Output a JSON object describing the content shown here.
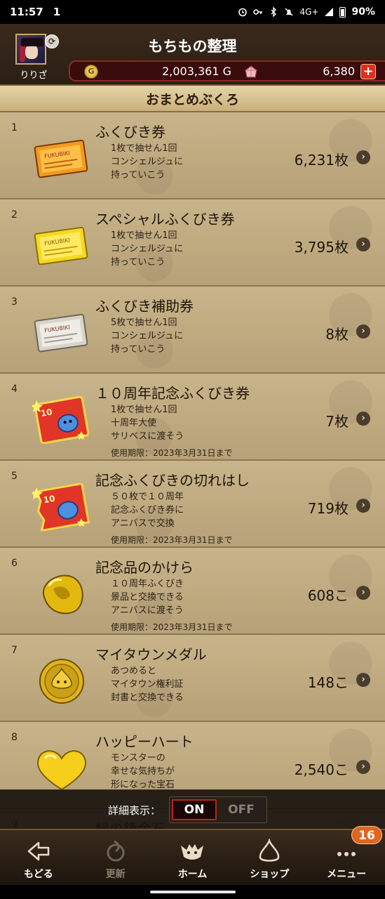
{
  "status_bar": {
    "time": "11:57",
    "notification": "1",
    "network": "4G+",
    "battery": "90%"
  },
  "header": {
    "title": "もちもの整理",
    "player_name": "りりざ",
    "gold": {
      "icon_label": "G",
      "amount": "2,003,361 G"
    },
    "gems": {
      "amount": "6,380"
    },
    "plus_label": "+"
  },
  "section_title": "おまとめぶくろ",
  "items": [
    {
      "num": "1",
      "title": "ふくびき券",
      "desc": [
        "1枚で抽せん1回",
        "コンシェルジュに",
        "持っていこう"
      ],
      "expiry": "",
      "count": "6,231枚",
      "icon": "ticket-orange-icon"
    },
    {
      "num": "2",
      "title": "スペシャルふくびき券",
      "desc": [
        "1枚で抽せん1回",
        "コンシェルジュに",
        "持っていこう"
      ],
      "expiry": "",
      "count": "3,795枚",
      "icon": "ticket-gold-icon"
    },
    {
      "num": "3",
      "title": "ふくびき補助券",
      "desc": [
        "5枚で抽せん1回",
        "コンシェルジュに",
        "持っていこう"
      ],
      "expiry": "",
      "count": "8枚",
      "icon": "ticket-silver-icon"
    },
    {
      "num": "4",
      "title": "１０周年記念ふくびき券",
      "desc": [
        "1枚で抽せん1回",
        "十周年大使",
        "サリベスに渡そう"
      ],
      "expiry": "使用期限：2023年3月31日まで",
      "count": "7枚",
      "icon": "anniversary-ticket-icon"
    },
    {
      "num": "5",
      "title": "記念ふくびきの切れはし",
      "desc": [
        "５０枚で１０周年",
        "記念ふくびき券に",
        "アニバスで交換"
      ],
      "expiry": "使用期限：2023年3月31日まで",
      "count": "719枚",
      "icon": "anniversary-ticket-scrap-icon"
    },
    {
      "num": "6",
      "title": "記念品のかけら",
      "desc": [
        "１０周年ふくびき",
        "景品と交換できる",
        "アニバスに渡そう"
      ],
      "expiry": "使用期限：2023年3月31日まで",
      "count": "608こ",
      "icon": "gold-fragment-icon"
    },
    {
      "num": "7",
      "title": "マイタウンメダル",
      "desc": [
        "あつめると",
        "マイタウン権利証",
        "封書と交換できる"
      ],
      "expiry": "",
      "count": "148こ",
      "icon": "gold-medal-icon"
    },
    {
      "num": "8",
      "title": "ハッピーハート",
      "desc": [
        "モンスターの",
        "幸せな気持ちが",
        "形になった宝石"
      ],
      "expiry": "",
      "count": "2,540こ",
      "icon": "gold-heart-icon"
    },
    {
      "num": "9",
      "title": "緑の錬金石",
      "desc": [],
      "expiry": "",
      "count": "",
      "icon": ""
    }
  ],
  "detail_toggle": {
    "label": "詳細表示：",
    "on": "ON",
    "off": "OFF",
    "state": "ON"
  },
  "nav": {
    "back": "もどる",
    "refresh": "更新",
    "home": "ホーム",
    "shop": "ショップ",
    "menu": "メニュー",
    "menu_badge": "16"
  },
  "colors": {
    "accent_red": "#b3261b",
    "badge_orange": "#e0661e",
    "parchment": "#c8b48a"
  }
}
